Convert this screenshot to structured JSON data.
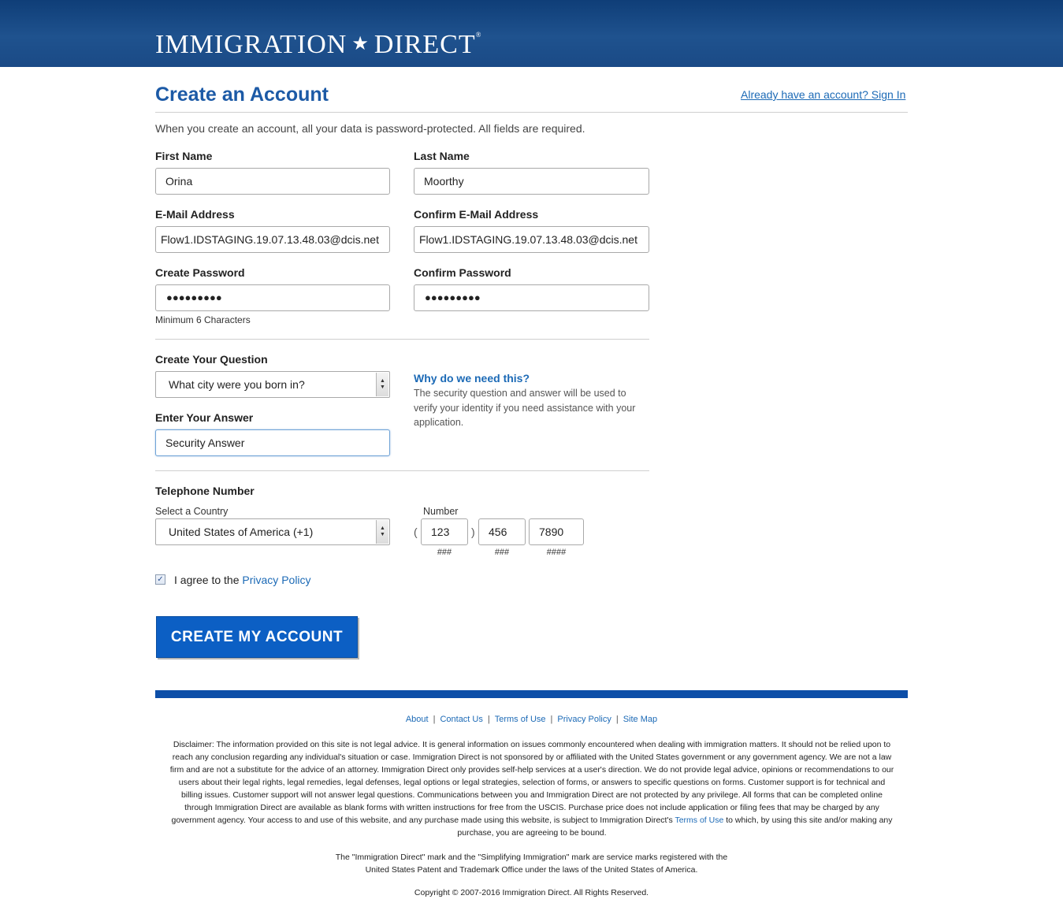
{
  "header": {
    "logo_left": "IMMIGRATION",
    "logo_star": "★",
    "logo_right": "DIRECT",
    "logo_mark": "®"
  },
  "page": {
    "title": "Create an Account",
    "signin_link": "Already have an account? Sign In",
    "intro": "When you create an account, all your data is password-protected. All fields are required."
  },
  "form": {
    "first_name_label": "First Name",
    "first_name_value": "Orina",
    "last_name_label": "Last Name",
    "last_name_value": "Moorthy",
    "email_label": "E-Mail Address",
    "email_value": "Flow1.IDSTAGING.19.07.13.48.03@dcis.net",
    "confirm_email_label": "Confirm E-Mail Address",
    "confirm_email_value": "Flow1.IDSTAGING.19.07.13.48.03@dcis.net",
    "password_label": "Create Password",
    "password_value": "●●●●●●●●●",
    "password_hint": "Minimum 6 Characters",
    "confirm_password_label": "Confirm Password",
    "confirm_password_value": "●●●●●●●●●",
    "question_label": "Create Your Question",
    "question_selected": "What city were you born in?",
    "answer_label": "Enter Your Answer",
    "answer_value": "Security Answer",
    "why_title": "Why do we need this?",
    "why_text": "The security question and answer will be used to verify your identity if you need assistance with your application.",
    "phone_label": "Telephone Number",
    "country_label": "Select a Country",
    "country_selected": "United States of America (+1)",
    "number_label": "Number",
    "paren_open": "(",
    "paren_close": ")",
    "phone_area": "123",
    "phone_prefix": "456",
    "phone_line": "7890",
    "mask_area": "###",
    "mask_prefix": "###",
    "mask_line": "####",
    "agree_checked": true,
    "checkbox_mark": "✓",
    "agree_text": "I agree to the",
    "privacy_link": "Privacy Policy",
    "submit_label": "CREATE MY ACCOUNT"
  },
  "footer": {
    "links": [
      "About",
      "Contact Us",
      "Terms of Use",
      "Privacy Policy",
      "Site Map"
    ],
    "separator": "|",
    "disclaimer_before": "Disclaimer: The information provided on this site is not legal advice. It is general information on issues commonly encountered when dealing with immigration matters. It should not be relied upon to reach any conclusion regarding any individual's situation or case. Immigration Direct is not sponsored by or affiliated with the United States government or any government agency. We are not a law firm and are not a substitute for the advice of an attorney. Immigration Direct only provides self-help services at a user's direction. We do not provide legal advice, opinions or recommendations to our users about their legal rights, legal remedies, legal defenses, legal options or legal strategies, selection of forms, or answers to specific questions on forms. Customer support is for technical and billing issues. Customer support will not answer legal questions. Communications between you and Immigration Direct are not protected by any privilege. All forms that can be completed online through Immigration Direct are available as blank forms with written instructions for free from the USCIS. Purchase price does not include application or filing fees that may be charged by any government agency. Your access to and use of this website, and any purchase made using this website, is subject to Immigration Direct's",
    "disclaimer_link": "Terms of Use",
    "disclaimer_after": "to which, by using this site and/or making any purchase, you are agreeing to be bound.",
    "marks_line1": "The \"Immigration Direct\" mark and the \"Simplifying Immigration\" mark are service marks registered with the",
    "marks_line2": "United States Patent and Trademark Office under the laws of the United States of America.",
    "copyright": "Copyright © 2007-2016 Immigration Direct. All Rights Reserved."
  },
  "colors": {
    "header_bg": "#1a4a86",
    "title": "#1c5aa6",
    "link": "#1c6ab6",
    "button": "#0c5fc4",
    "footer_bar": "#0c4ea8"
  }
}
